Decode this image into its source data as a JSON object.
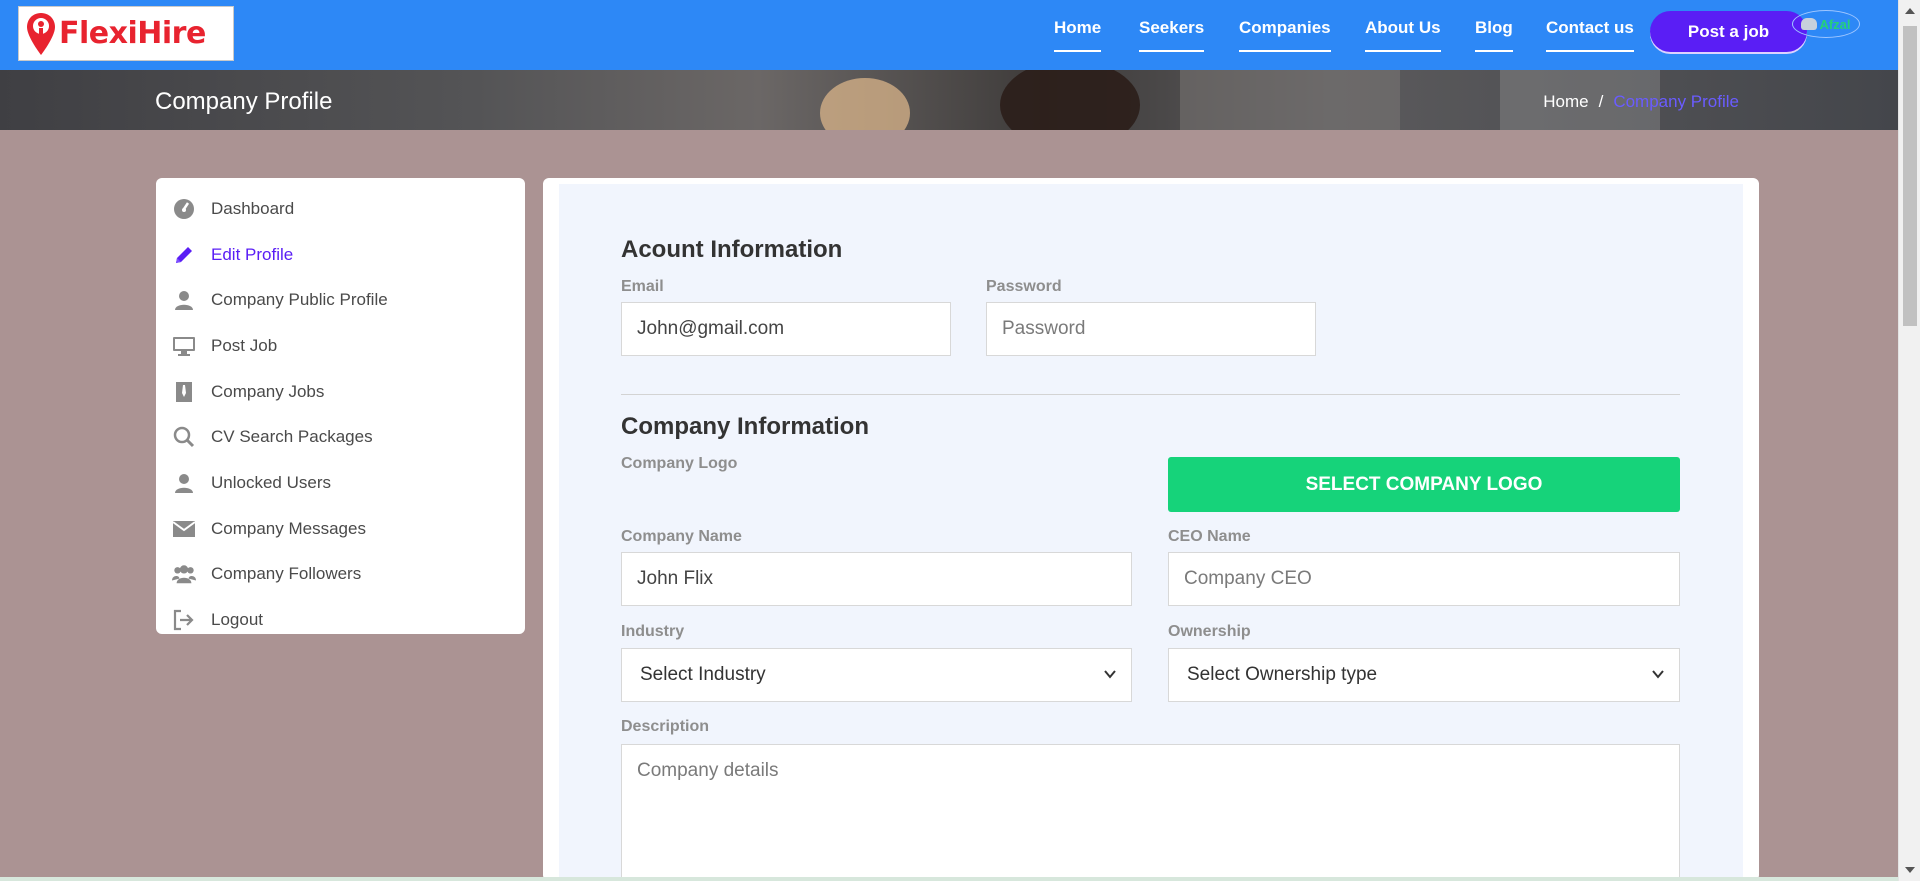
{
  "brand": {
    "name": "FlexiHire"
  },
  "nav": {
    "items": [
      {
        "label": "Home"
      },
      {
        "label": "Seekers"
      },
      {
        "label": "Companies"
      },
      {
        "label": "About Us"
      },
      {
        "label": "Blog"
      },
      {
        "label": "Contact us"
      }
    ],
    "post_job": "Post a job",
    "user": "Afzal"
  },
  "banner": {
    "title": "Company Profile",
    "breadcrumb": {
      "home": "Home",
      "sep": "/",
      "current": "Company Profile"
    }
  },
  "sidebar": {
    "items": [
      {
        "label": "Dashboard",
        "icon": "dashboard-icon"
      },
      {
        "label": "Edit Profile",
        "icon": "pencil-icon",
        "active": true
      },
      {
        "label": "Company Public Profile",
        "icon": "user-icon"
      },
      {
        "label": "Post Job",
        "icon": "desktop-icon"
      },
      {
        "label": "Company Jobs",
        "icon": "briefcase-icon"
      },
      {
        "label": "CV Search Packages",
        "icon": "search-icon"
      },
      {
        "label": "Unlocked Users",
        "icon": "user-icon"
      },
      {
        "label": "Company Messages",
        "icon": "envelope-icon"
      },
      {
        "label": "Company Followers",
        "icon": "users-icon"
      },
      {
        "label": "Logout",
        "icon": "logout-icon"
      }
    ]
  },
  "account": {
    "heading": "Acount Information",
    "email_label": "Email",
    "email_value": "John@gmail.com",
    "password_label": "Password",
    "password_placeholder": "Password"
  },
  "company": {
    "heading": "Company Information",
    "logo_label": "Company Logo",
    "logo_button": "SELECT COMPANY LOGO",
    "name_label": "Company Name",
    "name_value": "John Flix",
    "ceo_label": "CEO Name",
    "ceo_placeholder": "Company CEO",
    "industry_label": "Industry",
    "industry_value": "Select Industry",
    "ownership_label": "Ownership",
    "ownership_value": "Select Ownership type",
    "description_label": "Description",
    "description_placeholder": "Company details"
  },
  "colors": {
    "header": "#2d88f6",
    "accent": "#5a1ef5",
    "success": "#16d37a",
    "background": "#ab9393"
  }
}
